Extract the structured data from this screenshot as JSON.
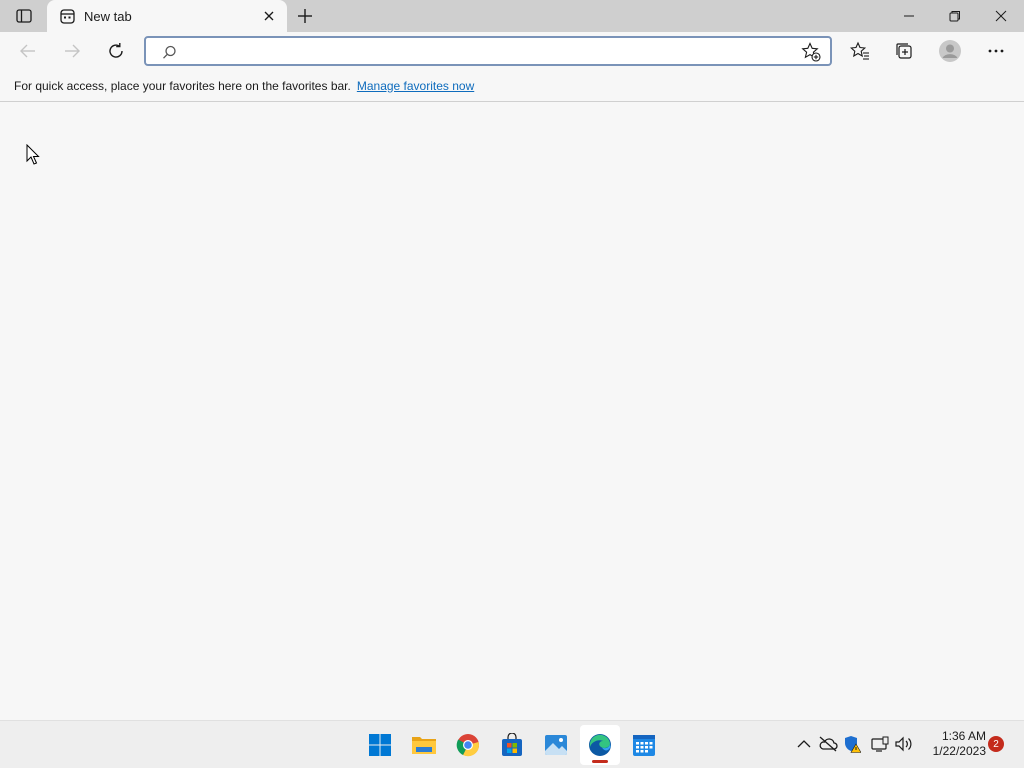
{
  "tab": {
    "title": "New tab"
  },
  "addressbar": {
    "value": "",
    "placeholder": ""
  },
  "favorites_bar": {
    "message": "For quick access, place your favorites here on the favorites bar.",
    "link": "Manage favorites now"
  },
  "taskbar": {
    "apps": [
      "start-icon",
      "file-explorer-icon",
      "chrome-icon",
      "microsoft-store-icon",
      "photos-icon",
      "edge-icon",
      "calendar-icon"
    ],
    "active_app": "edge-icon"
  },
  "clock": {
    "time": "1:36 AM",
    "date": "1/22/2023"
  },
  "notifications": {
    "count": "2"
  },
  "colors": {
    "accent": "#0f6cbd",
    "tab_strip": "#cfcfcf",
    "badge": "#c42b1c"
  }
}
